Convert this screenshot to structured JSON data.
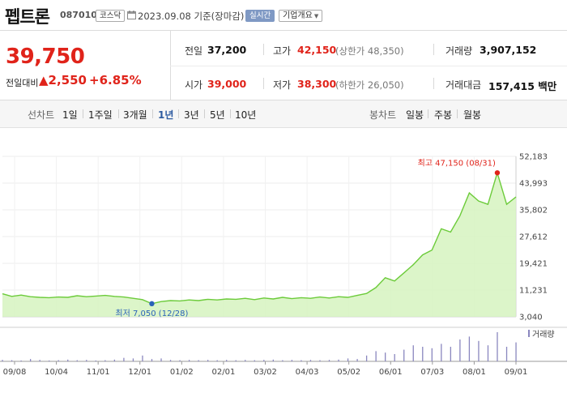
{
  "header": {
    "name": "펩트론",
    "code": "087010",
    "market": "코스닥",
    "date": "2023.09.08 기준(장마감)",
    "live_label": "실시간",
    "company_label": "기업개요"
  },
  "quote": {
    "price": "39,750",
    "diff_label": "전일대비",
    "diff_value": "▲2,550",
    "rate": "+6.85%",
    "prev_close_label": "전일",
    "prev_close": "37,200",
    "high_label": "고가",
    "high": "42,150",
    "upper_limit": "(상한가 48,350)",
    "volume_label": "거래량",
    "volume": "3,907,152",
    "open_label": "시가",
    "open": "39,000",
    "low_label": "저가",
    "low": "38,300",
    "lower_limit": "(하한가 26,050)",
    "amount_label": "거래대금",
    "amount": "157,415 백만"
  },
  "tabs": {
    "line_label": "선차트",
    "line_periods": [
      "1일",
      "1주일",
      "3개월",
      "1년",
      "3년",
      "5년",
      "10년"
    ],
    "selected": "1년",
    "candle_label": "봉차트",
    "candle_periods": [
      "일봉",
      "주봉",
      "월봉"
    ]
  },
  "colors": {
    "up": "#e0231a",
    "selected_tab": "#2c5aa0",
    "line": "#6ccb3a",
    "area": "#d6f3c0",
    "volume_bar": "#8a87bf"
  },
  "chart_data": {
    "type": "area",
    "ylim": [
      3040,
      52183
    ],
    "y_ticks": [
      "52,183",
      "43,993",
      "35,802",
      "27,612",
      "19,421",
      "11,231",
      "3,040"
    ],
    "x_ticks": [
      "09/08",
      "10/04",
      "11/01",
      "12/01",
      "01/02",
      "02/01",
      "03/02",
      "04/03",
      "05/02",
      "06/01",
      "07/03",
      "08/01",
      "09/01"
    ],
    "high_annotation": "최고 47,150 (08/31)",
    "low_annotation": "최저 7,050 (12/28)",
    "high": {
      "date": "08/31",
      "value": 47150
    },
    "low": {
      "date": "12/28",
      "value": 7050
    },
    "volume_legend": "거래량",
    "x": [
      "09/08",
      "09/15",
      "09/22",
      "09/29",
      "10/06",
      "10/13",
      "10/20",
      "10/27",
      "11/03",
      "11/10",
      "11/17",
      "11/24",
      "12/01",
      "12/08",
      "12/15",
      "12/22",
      "12/28",
      "01/05",
      "01/12",
      "01/19",
      "01/26",
      "02/02",
      "02/09",
      "02/16",
      "02/23",
      "03/02",
      "03/09",
      "03/16",
      "03/23",
      "03/30",
      "04/06",
      "04/13",
      "04/20",
      "04/27",
      "05/04",
      "05/11",
      "05/18",
      "05/25",
      "06/01",
      "06/08",
      "06/15",
      "06/22",
      "06/29",
      "07/06",
      "07/13",
      "07/20",
      "07/27",
      "08/03",
      "08/07",
      "08/11",
      "08/17",
      "08/21",
      "08/25",
      "08/31",
      "09/04",
      "09/08"
    ],
    "values": [
      10100,
      9300,
      9700,
      9200,
      9000,
      8900,
      9100,
      9000,
      9500,
      9200,
      9400,
      9600,
      9300,
      9100,
      8700,
      8300,
      7050,
      7700,
      8000,
      7900,
      8200,
      8000,
      8400,
      8200,
      8500,
      8400,
      8700,
      8300,
      8800,
      8500,
      9000,
      8600,
      8900,
      8700,
      9100,
      8800,
      9200,
      9000,
      9600,
      10200,
      12000,
      15000,
      14000,
      16500,
      19000,
      22000,
      23500,
      30000,
      29000,
      34000,
      41000,
      38500,
      37500,
      47150,
      37500,
      39750
    ],
    "volume_unit": "relative",
    "volume": [
      0.05,
      0.04,
      0.03,
      0.08,
      0.05,
      0.03,
      0.04,
      0.06,
      0.04,
      0.05,
      0.03,
      0.04,
      0.06,
      0.12,
      0.1,
      0.2,
      0.08,
      0.1,
      0.05,
      0.04,
      0.05,
      0.04,
      0.05,
      0.04,
      0.05,
      0.04,
      0.05,
      0.04,
      0.05,
      0.06,
      0.04,
      0.05,
      0.04,
      0.05,
      0.04,
      0.05,
      0.06,
      0.1,
      0.08,
      0.2,
      0.35,
      0.3,
      0.25,
      0.4,
      0.55,
      0.5,
      0.45,
      0.6,
      0.5,
      0.75,
      0.85,
      0.7,
      0.55,
      1.0,
      0.5,
      0.65
    ]
  }
}
